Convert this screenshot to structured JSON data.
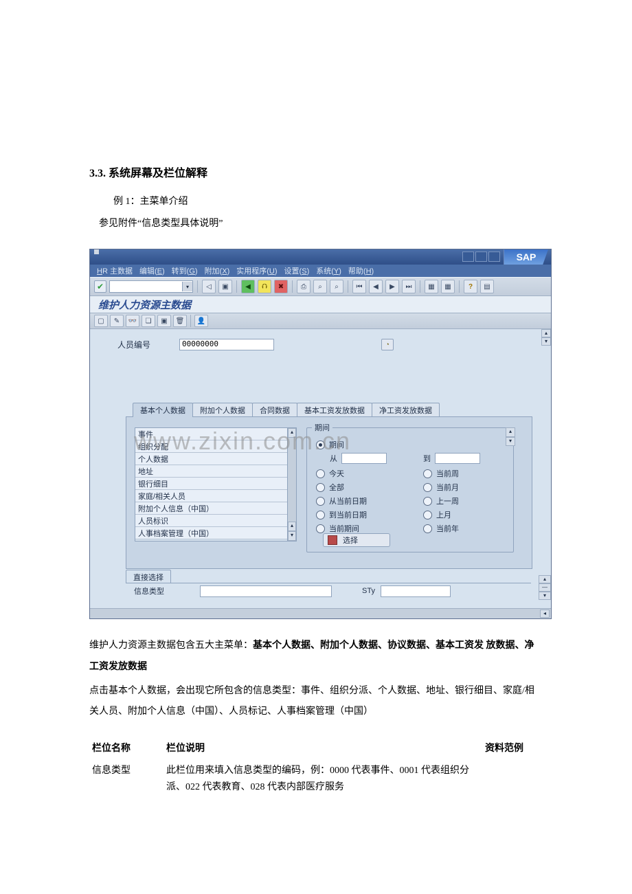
{
  "doc": {
    "heading": "3.3.  系统屏幕及栏位解释",
    "line1": "例 1：主菜单介绍",
    "line2": "参见附件“信息类型具体说明”",
    "after1a": "维护人力资源主数据包含五大主菜单：",
    "after1b": "基本个人数据、附加个人数据、协议数据、基本工资发 放数据、净工资发放数据",
    "after2": "点击基本个人数据，会出现它所包含的信息类型：事件、组织分派、个人数据、地址、银行细目、家庭/相关人员、附加个人信息（中国）、人员标记、人事档案管理（中国）",
    "th_name": "栏位名称",
    "th_desc": "栏位说明",
    "th_ex": "资料范例",
    "td_name": "信息类型",
    "td_desc": "此栏位用来填入信息类型的编码，例：0000 代表事件、0001 代表组织分派、022 代表教育、028 代表内部医疗服务"
  },
  "sap": {
    "logo": "SAP",
    "menu": {
      "m0a": "H",
      "m0b": "R",
      "m0c": " 主数据",
      "m1a": "编辑(",
      "m1u": "E",
      "m1b": ")",
      "m2a": "转到(",
      "m2u": "G",
      "m2b": ")",
      "m3a": "附加(",
      "m3u": "X",
      "m3b": ")",
      "m4a": "实用程序(",
      "m4u": "U",
      "m4b": ")",
      "m5a": "设置(",
      "m5u": "S",
      "m5b": ")",
      "m6a": "系统(",
      "m6u": "Y",
      "m6b": ")",
      "m7a": "帮助(",
      "m7u": "H",
      "m7b": ")"
    },
    "title": "维护人力资源主数据",
    "emp_label": "人员编号",
    "emp_value": "00000000",
    "tabs": {
      "t0": "基本个人数据",
      "t1": "附加个人数据",
      "t2": "合同数据",
      "t3": "基本工资发放数据",
      "t4": "净工资发放数据"
    },
    "list": {
      "i0": "事件",
      "i1": "组织分配",
      "i2": "个人数据",
      "i3": "地址",
      "i4": "银行细目",
      "i5": "家庭/相关人员",
      "i6": "附加个人信息（中国）",
      "i7": "人员标识",
      "i8": "人事档案管理（中国）"
    },
    "period_legend": "期间",
    "period": {
      "r_period": "期间",
      "from": "从",
      "to": "到",
      "today": "今天",
      "cur_week": "当前周",
      "all": "全部",
      "cur_month": "当前月",
      "from_cur": "从当前日期",
      "last_week": "上一周",
      "to_cur": "到当前日期",
      "last_month": "上月",
      "cur_period": "当前期间",
      "cur_year": "当前年",
      "select_btn": "选择"
    },
    "direct_tab": "直接选择",
    "direct": {
      "info_type": "信息类型",
      "sty": "STy"
    },
    "watermark": "www.zixin.com.cn"
  }
}
